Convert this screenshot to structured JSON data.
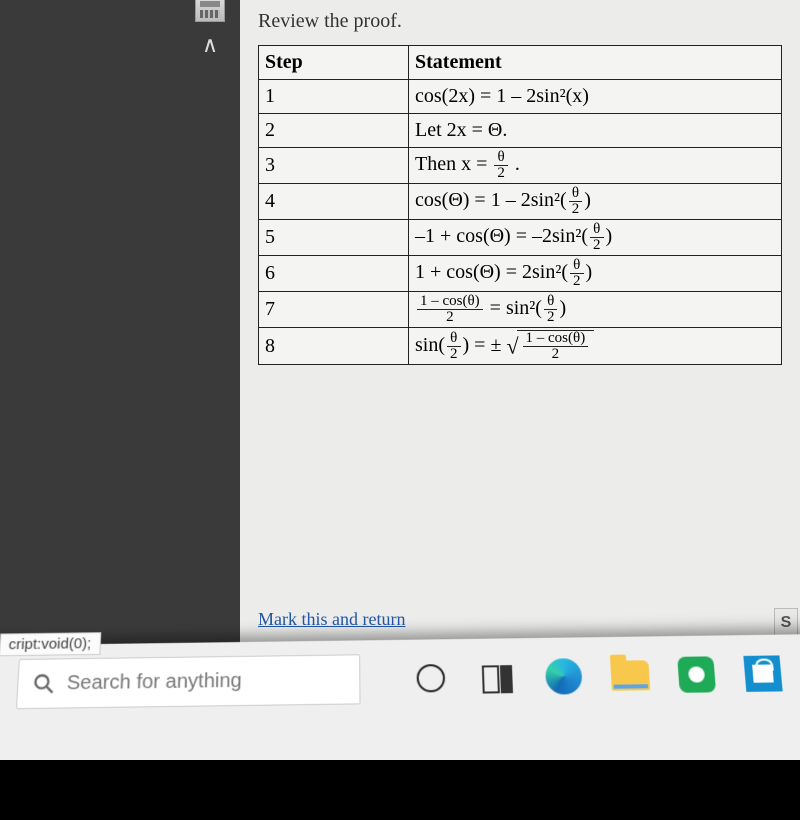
{
  "page": {
    "instruction": "Review the proof.",
    "mark_return": "Mark this and return",
    "side_button": "S"
  },
  "table": {
    "headers": {
      "step": "Step",
      "statement": "Statement"
    },
    "rows": [
      {
        "step": "1",
        "plain": "cos(2x) = 1 – 2sin²(x)"
      },
      {
        "step": "2",
        "plain": "Let 2x = Θ."
      },
      {
        "step": "3",
        "prefix": "Then x = ",
        "frac_n": "θ",
        "frac_d": "2",
        "suffix": "."
      },
      {
        "step": "4",
        "prefix": "cos(Θ) = 1 – 2sin²",
        "paren_frac_n": "θ",
        "paren_frac_d": "2"
      },
      {
        "step": "5",
        "prefix": "–1 + cos(Θ) = –2sin²",
        "paren_frac_n": "θ",
        "paren_frac_d": "2"
      },
      {
        "step": "6",
        "prefix": "1 + cos(Θ) = 2sin²",
        "paren_frac_n": "θ",
        "paren_frac_d": "2"
      },
      {
        "step": "7",
        "lead_frac_n": "1 – cos(θ)",
        "lead_frac_d": "2",
        "mid": " = sin²",
        "paren_frac_n": "θ",
        "paren_frac_d": "2"
      },
      {
        "step": "8",
        "sin_frac_n": "θ",
        "sin_frac_d": "2",
        "eq": " = ± ",
        "sqrt_frac_n": "1 – cos(θ)",
        "sqrt_frac_d": "2"
      }
    ]
  },
  "taskbar": {
    "tooltip": "cript:void(0);",
    "search_placeholder": "Search for anything"
  }
}
